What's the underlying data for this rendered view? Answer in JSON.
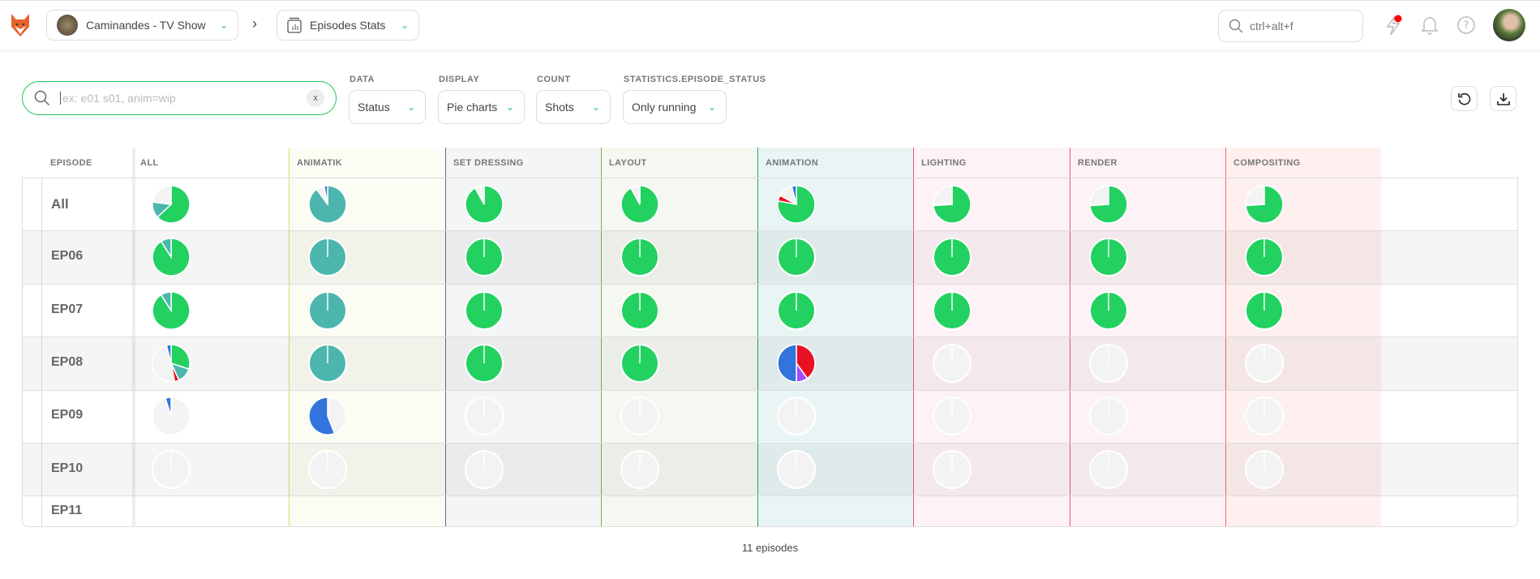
{
  "topbar": {
    "project": "Caminandes - TV Show",
    "section": "Episodes Stats",
    "search_placeholder": "ctrl+alt+f"
  },
  "filters": {
    "search_placeholder": "ex: e01 s01, anim=wip",
    "clear_label": "x",
    "data": {
      "label": "DATA",
      "value": "Status"
    },
    "display": {
      "label": "DISPLAY",
      "value": "Pie charts"
    },
    "count": {
      "label": "COUNT",
      "value": "Shots"
    },
    "episode_status": {
      "label": "STATISTICS.EPISODE_STATUS",
      "value": "Only running"
    }
  },
  "colors": {
    "green": "#22d160",
    "teal": "#4db6ac",
    "blue": "#3273dc",
    "red": "#e81123",
    "purple": "#a24bff",
    "yellow": "#f5a623",
    "gray": "#f3f3f3",
    "accent": "#22c55e"
  },
  "table": {
    "episode_header": "EPISODE",
    "columns": [
      {
        "name": "ALL",
        "border": "#e0e0e0",
        "bg": "#ffffff"
      },
      {
        "name": "ANIMATIK",
        "border": "#d4df63",
        "bg": "#fbfcf4"
      },
      {
        "name": "SET DRESSING",
        "border": "#5e7085",
        "bg": "#f4f5f7"
      },
      {
        "name": "LAYOUT",
        "border": "#7cb342",
        "bg": "#f5f8f0"
      },
      {
        "name": "ANIMATION",
        "border": "#26998a",
        "bg": "#e9f5f5"
      },
      {
        "name": "LIGHTING",
        "border": "#e8577a",
        "bg": "#fdf2f5"
      },
      {
        "name": "RENDER",
        "border": "#e8577a",
        "bg": "#fdf2f5"
      },
      {
        "name": "COMPOSITING",
        "border": "#ee6b6b",
        "bg": "#fdf0ef"
      }
    ],
    "rows": [
      {
        "name": "All",
        "pies": [
          [
            [
              "green",
              0.63
            ],
            [
              "teal",
              0.14
            ],
            [
              "gray",
              0.23
            ]
          ],
          [
            [
              "teal",
              0.9
            ],
            [
              "gray",
              0.07
            ],
            [
              "blue",
              0.03
            ]
          ],
          [
            [
              "green",
              0.92
            ],
            [
              "gray",
              0.08
            ]
          ],
          [
            [
              "green",
              0.92
            ],
            [
              "gray",
              0.08
            ]
          ],
          [
            [
              "green",
              0.78
            ],
            [
              "red",
              0.05
            ],
            [
              "gray",
              0.13
            ],
            [
              "blue",
              0.04
            ]
          ],
          [
            [
              "green",
              0.74
            ],
            [
              "yellow",
              0.01
            ],
            [
              "gray",
              0.25
            ]
          ],
          [
            [
              "green",
              0.74
            ],
            [
              "gray",
              0.26
            ]
          ],
          [
            [
              "green",
              0.74
            ],
            [
              "gray",
              0.26
            ]
          ]
        ]
      },
      {
        "name": "EP06",
        "pies": [
          [
            [
              "green",
              0.91
            ],
            [
              "teal",
              0.09
            ]
          ],
          [
            [
              "teal",
              1
            ]
          ],
          [
            [
              "green",
              1
            ]
          ],
          [
            [
              "green",
              1
            ]
          ],
          [
            [
              "green",
              1
            ]
          ],
          [
            [
              "green",
              1
            ]
          ],
          [
            [
              "green",
              1
            ]
          ],
          [
            [
              "green",
              1
            ]
          ]
        ]
      },
      {
        "name": "EP07",
        "pies": [
          [
            [
              "green",
              0.91
            ],
            [
              "teal",
              0.09
            ]
          ],
          [
            [
              "teal",
              1
            ]
          ],
          [
            [
              "green",
              1
            ]
          ],
          [
            [
              "green",
              1
            ]
          ],
          [
            [
              "green",
              1
            ]
          ],
          [
            [
              "green",
              1
            ]
          ],
          [
            [
              "green",
              1
            ]
          ],
          [
            [
              "green",
              1
            ]
          ]
        ]
      },
      {
        "name": "EP08",
        "pies": [
          [
            [
              "green",
              0.3
            ],
            [
              "teal",
              0.13
            ],
            [
              "red",
              0.04
            ],
            [
              "gray",
              0.49
            ],
            [
              "blue",
              0.04
            ]
          ],
          [
            [
              "teal",
              1
            ]
          ],
          [
            [
              "green",
              1
            ]
          ],
          [
            [
              "green",
              1
            ]
          ],
          [
            [
              "red",
              0.4
            ],
            [
              "purple",
              0.1
            ],
            [
              "blue",
              0.5
            ]
          ],
          [
            [
              "gray",
              1
            ]
          ],
          [
            [
              "gray",
              1
            ]
          ],
          [
            [
              "gray",
              1
            ]
          ]
        ]
      },
      {
        "name": "EP09",
        "pies": [
          [
            [
              "gray",
              0.95
            ],
            [
              "blue",
              0.05
            ]
          ],
          [
            [
              "gray",
              0.44
            ],
            [
              "blue",
              0.56
            ]
          ],
          [
            [
              "gray",
              1
            ]
          ],
          [
            [
              "gray",
              1
            ]
          ],
          [
            [
              "gray",
              1
            ]
          ],
          [
            [
              "gray",
              1
            ]
          ],
          [
            [
              "gray",
              1
            ]
          ],
          [
            [
              "gray",
              1
            ]
          ]
        ]
      },
      {
        "name": "EP10",
        "pies": [
          [
            [
              "gray",
              1
            ]
          ],
          [
            [
              "gray",
              1
            ]
          ],
          [
            [
              "gray",
              1
            ]
          ],
          [
            [
              "gray",
              1
            ]
          ],
          [
            [
              "gray",
              1
            ]
          ],
          [
            [
              "gray",
              1
            ]
          ],
          [
            [
              "gray",
              1
            ]
          ],
          [
            [
              "gray",
              1
            ]
          ]
        ]
      },
      {
        "name": "EP11",
        "pies": []
      }
    ]
  },
  "footer": {
    "count": "11 episodes"
  }
}
